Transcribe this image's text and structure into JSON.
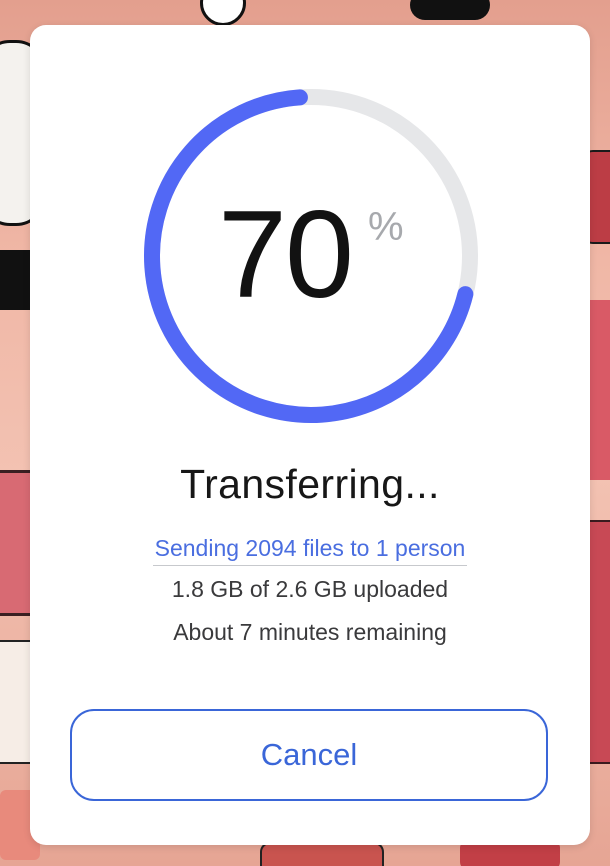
{
  "progress": {
    "percent_value": 70,
    "percent_text": "70",
    "percent_sign": "%",
    "track_color": "#e6e7e9",
    "fill_color": "#5268f5"
  },
  "title": "Transferring...",
  "status": {
    "sending": "Sending 2094 files to 1 person",
    "uploaded": "1.8 GB of 2.6 GB uploaded",
    "remaining": "About 7 minutes remaining"
  },
  "actions": {
    "cancel_label": "Cancel"
  }
}
